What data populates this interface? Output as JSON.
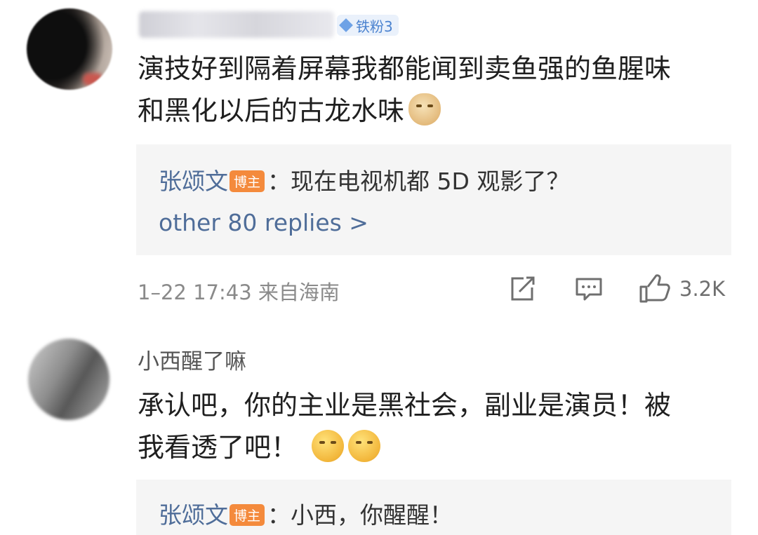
{
  "comment1": {
    "badge": "铁粉3",
    "text_line1": "演技好到隔着屏幕我都能闻到卖鱼强的鱼腥味",
    "text_line2": "和黑化以后的古龙水味",
    "emoji": "doge-icon",
    "reply": {
      "author": "张颂文",
      "author_tag": "博主",
      "text": "：现在电视机都 5D 观影了？"
    },
    "more_replies": "other 80 replies >",
    "meta": "1–22 17:43  来自海南",
    "likes": "3.2K"
  },
  "comment2": {
    "username": "小西醒了嘛",
    "text_line1": "承认吧，你的主业是黑社会，副业是演员！被",
    "text_line2": "我看透了吧！",
    "emoji": "shush-face-icon",
    "reply": {
      "author": "张颂文",
      "author_tag": "博主",
      "text": "：小西，你醒醒！"
    }
  },
  "colors": {
    "link": "#4f6d99",
    "blogger_tag": "#f48a3c",
    "fans_badge": "#4a82cf",
    "reply_bg": "#f5f5f5"
  }
}
